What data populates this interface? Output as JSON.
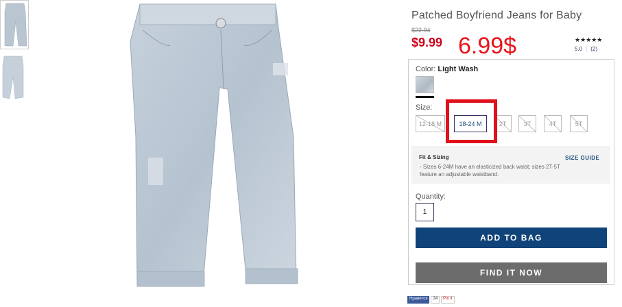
{
  "product": {
    "title": "Patched Boyfriend Jeans for Baby",
    "old_price": "$22.94",
    "price": "$9.99",
    "handwritten_note": "6.99$",
    "stars": "★★★★★",
    "rating_value": "5.0",
    "review_count": "(2)"
  },
  "color": {
    "label": "Color:",
    "value": "Light Wash"
  },
  "size": {
    "label": "Size:",
    "options": [
      {
        "label": "12-18 M",
        "available": false
      },
      {
        "label": "18-24 M",
        "available": true,
        "selected": true
      },
      {
        "label": "2T",
        "available": false
      },
      {
        "label": "3T",
        "available": false
      },
      {
        "label": "4T",
        "available": false
      },
      {
        "label": "5T",
        "available": false
      }
    ]
  },
  "fit": {
    "title": "Fit & Sizing",
    "guide_link": "SIZE GUIDE",
    "text": "- Sizes 6-24M have an elasticized back waist; sizes 2T-5T feature an adjustable waistband."
  },
  "quantity": {
    "label": "Quantity:",
    "value": "1"
  },
  "buttons": {
    "add": "ADD TO BAG",
    "find": "FIND IT NOW"
  },
  "social": {
    "facebook": "Нравится",
    "count": "24",
    "pinterest": "Pin it"
  },
  "colors": {
    "price_red": "#d0021b",
    "add_blue": "#0f4379",
    "find_gray": "#6c6c6c",
    "annotation_red": "#e0111b"
  }
}
